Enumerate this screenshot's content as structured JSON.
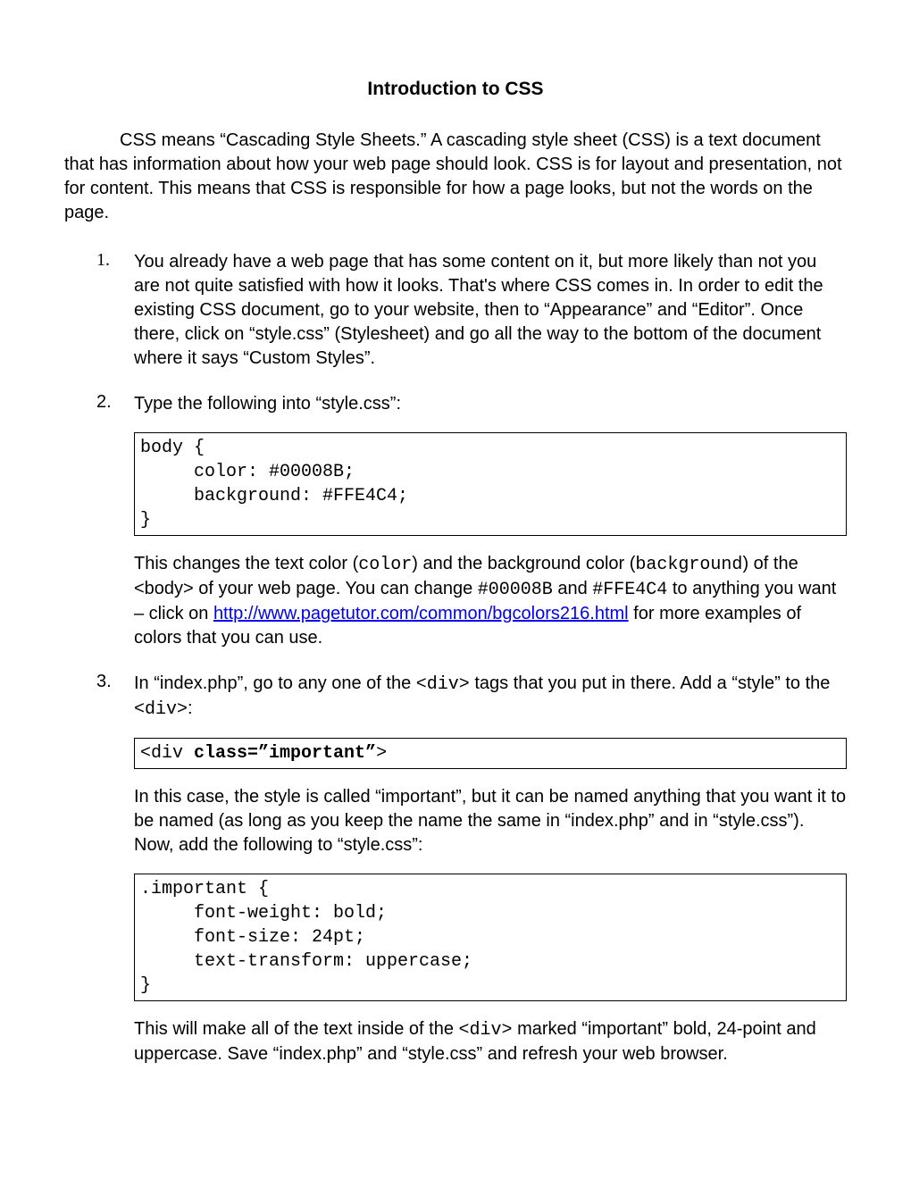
{
  "title": "Introduction to CSS",
  "intro": "CSS means “Cascading Style Sheets.”  A cascading style sheet (CSS) is a text document that has information about how your web page should look.  CSS is for layout and presentation, not for content.  This means that CSS is responsible for how a page looks, but not the words on the page.",
  "items": [
    {
      "num": "1.",
      "text": "You already have a web page that has some content on it, but more likely than not you are not quite satisfied with how it looks.  That's where CSS comes in.  In order to edit the existing CSS document, go to your website, then to “Appearance” and “Editor”.  Once there, click on “style.css” (Stylesheet) and go all the way to the bottom of the document where it says “Custom Styles”."
    },
    {
      "num": "2.",
      "text": "Type the following into “style.css”:",
      "code1": "body {\n     color: #00008B;\n     background: #FFE4C4;\n}",
      "p2a": "This changes the text color (",
      "p2b": "color",
      "p2c": ") and the background color (",
      "p2d": "background",
      "p2e": ") of the <body> of your web page.  You can change ",
      "p2f": "#00008B",
      "p2g": " and ",
      "p2h": "#FFE4C4",
      "p2i": " to anything you want – click on ",
      "link": "http://www.pagetutor.com/common/bgcolors216.html",
      "p2j": " for more examples of colors that you can use."
    },
    {
      "num": "3.",
      "text3a": "In “index.php”, go to any one of the ",
      "text3b": "<div>",
      "text3c": " tags that you put in there.  Add a “style” to the ",
      "text3d": "<div>",
      "text3e": ":",
      "code3a_a": "<div ",
      "code3a_b": "class=”important”",
      "code3a_c": ">",
      "p3a": "In this case, the style is called “important”, but it can be named anything that you want it to be named (as long as you keep the name the same in “index.php” and in “style.css”).  Now, add the following to “style.css”:",
      "code3b": ".important {\n     font-weight: bold;\n     font-size: 24pt;\n     text-transform: uppercase;\n}",
      "p3b_a": "This will make all of the text inside of the ",
      "p3b_b": "<div>",
      "p3b_c": " marked “important” bold, 24-point and uppercase.  Save “index.php” and “style.css” and refresh your web browser."
    }
  ]
}
